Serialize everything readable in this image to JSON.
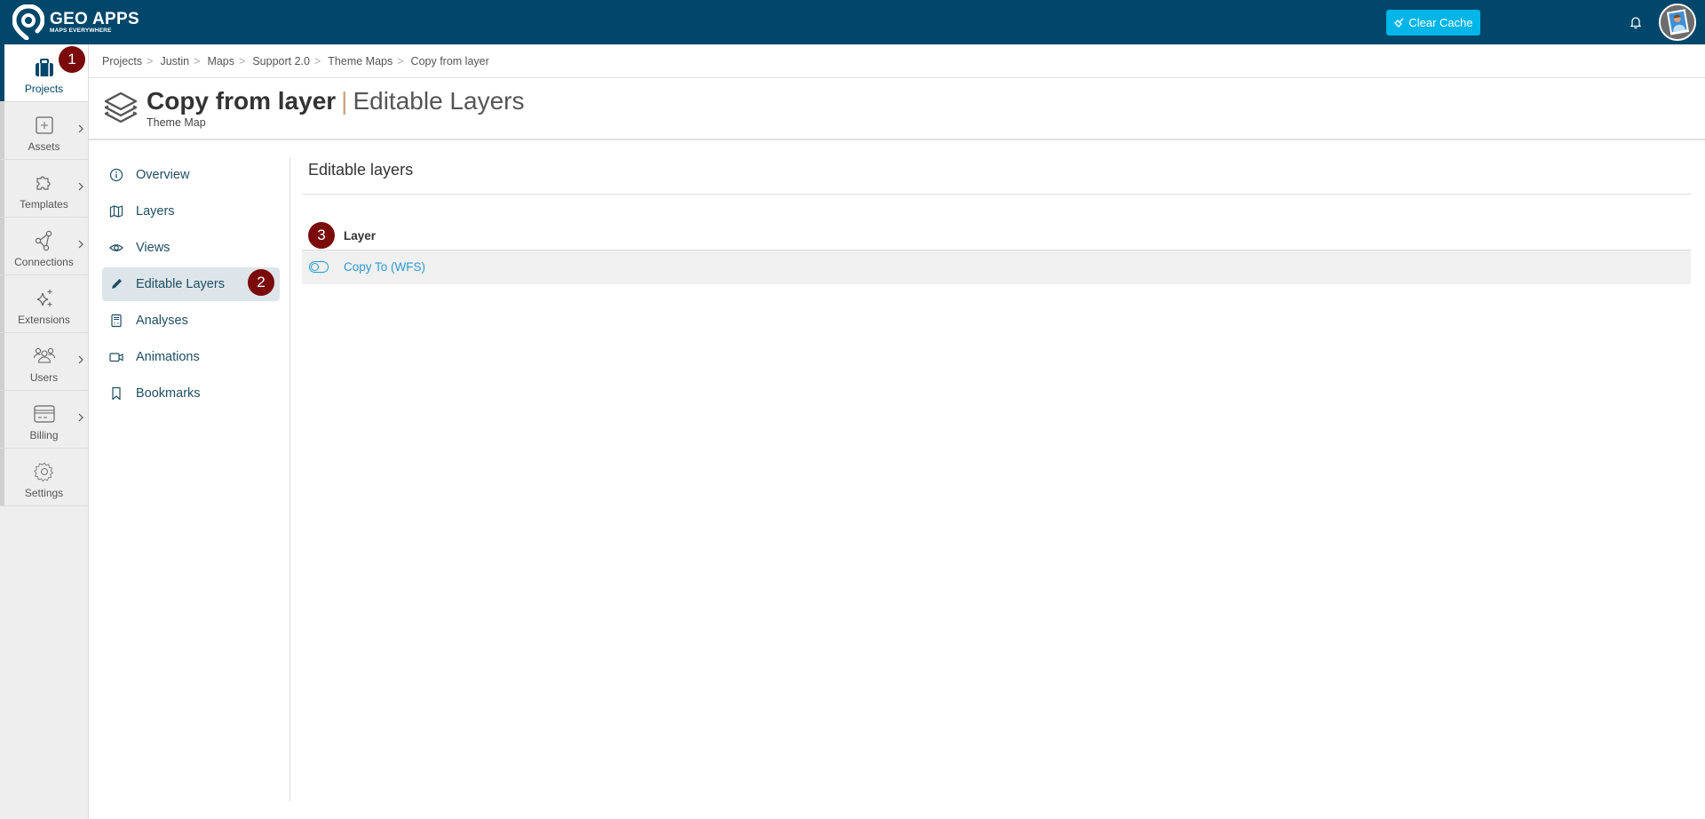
{
  "brand": {
    "title": "GEO APPS",
    "subtitle": "MAPS EVERYWHERE"
  },
  "topbar": {
    "clear_cache_label": "Clear Cache",
    "clear_cache_color": "#00b5e8",
    "notification_icon": "bell-icon",
    "avatar_icon": "user-avatar"
  },
  "left_nav": {
    "items": [
      {
        "label": "Projects",
        "icon": "briefcase-icon",
        "active": true,
        "has_submenu": false
      },
      {
        "label": "Assets",
        "icon": "plus-square-icon",
        "active": false,
        "has_submenu": true
      },
      {
        "label": "Templates",
        "icon": "puzzle-icon",
        "active": false,
        "has_submenu": true
      },
      {
        "label": "Connections",
        "icon": "share-nodes-icon",
        "active": false,
        "has_submenu": true
      },
      {
        "label": "Extensions",
        "icon": "sparkle-icon",
        "active": false,
        "has_submenu": false
      },
      {
        "label": "Users",
        "icon": "users-icon",
        "active": false,
        "has_submenu": true
      },
      {
        "label": "Billing",
        "icon": "credit-card-icon",
        "active": false,
        "has_submenu": true
      },
      {
        "label": "Settings",
        "icon": "gear-icon",
        "active": false,
        "has_submenu": false
      }
    ]
  },
  "annotations": {
    "step1": "1",
    "step2": "2",
    "step3": "3",
    "color": "#7b0a0a"
  },
  "breadcrumb": {
    "items": [
      "Projects",
      "Justin",
      "Maps",
      "Support 2.0",
      "Theme Maps",
      "Copy from layer"
    ],
    "separator": ">"
  },
  "page_header": {
    "title": "Copy from layer",
    "separator": "|",
    "section": "Editable Layers",
    "subtitle": "Theme Map"
  },
  "sub_nav": {
    "items": [
      {
        "label": "Overview",
        "icon": "info-icon",
        "active": false
      },
      {
        "label": "Layers",
        "icon": "map-icon",
        "active": false
      },
      {
        "label": "Views",
        "icon": "eye-icon",
        "active": false
      },
      {
        "label": "Editable Layers",
        "icon": "pencil-icon",
        "active": true
      },
      {
        "label": "Analyses",
        "icon": "calculator-icon",
        "active": false
      },
      {
        "label": "Animations",
        "icon": "video-icon",
        "active": false
      },
      {
        "label": "Bookmarks",
        "icon": "bookmark-icon",
        "active": false
      }
    ]
  },
  "content": {
    "title": "Editable layers",
    "table": {
      "columns": [
        "Layer"
      ],
      "rows": [
        {
          "layer": "Copy To (WFS)",
          "enabled": false
        }
      ]
    }
  }
}
